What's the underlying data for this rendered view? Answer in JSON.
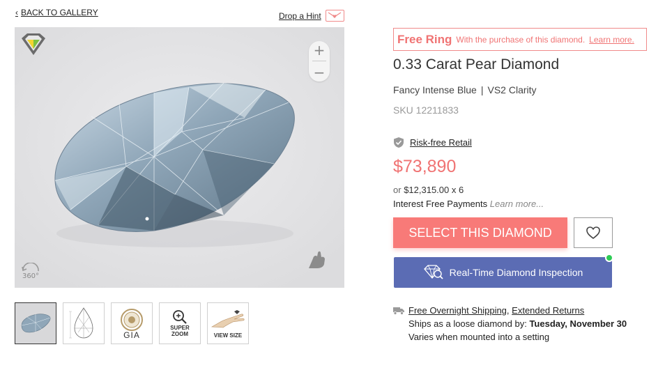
{
  "nav": {
    "back_label": "BACK TO GALLERY",
    "hint_label": "Drop a Hint"
  },
  "viewer": {
    "zoom_in": "+",
    "zoom_out": "−",
    "rotate_label": "360°"
  },
  "thumbnails": [
    {
      "label": "",
      "icon": "diamond-photo"
    },
    {
      "label": "",
      "icon": "pear-diagram"
    },
    {
      "label": "GIA",
      "icon": "gia-seal"
    },
    {
      "label": "SUPER ZOOM",
      "line1": "SUPER",
      "line2": "ZOOM",
      "icon": "magnifier"
    },
    {
      "label": "VIEW SIZE",
      "icon": "hand-size"
    }
  ],
  "promo": {
    "title": "Free Ring",
    "text": "With the purchase of this diamond.",
    "link": "Learn more."
  },
  "product": {
    "title": "0.33 Carat Pear Diamond",
    "color": "Fancy Intense Blue",
    "separator": "|",
    "clarity": "VS2 Clarity",
    "sku": "SKU 12211833",
    "risk_free": "Risk-free Retail",
    "price": "$73,890",
    "finance_or": "or",
    "finance_amount": "$12,315.00 x 6",
    "interest_text": "Interest Free Payments",
    "interest_link": "Learn more..."
  },
  "actions": {
    "select": "SELECT THIS DIAMOND",
    "inspect": "Real-Time Diamond Inspection"
  },
  "shipping": {
    "free_overnight": "Free Overnight Shipping",
    "comma": ",",
    "extended_returns": "Extended Returns",
    "ships_prefix": "Ships as a loose diamond by:",
    "ships_date": "Tuesday, November 30",
    "mounted": "Varies when mounted into a setting"
  },
  "colors": {
    "accent": "#f87a78",
    "inspect": "#5b6cb4",
    "online": "#2ecc55"
  }
}
